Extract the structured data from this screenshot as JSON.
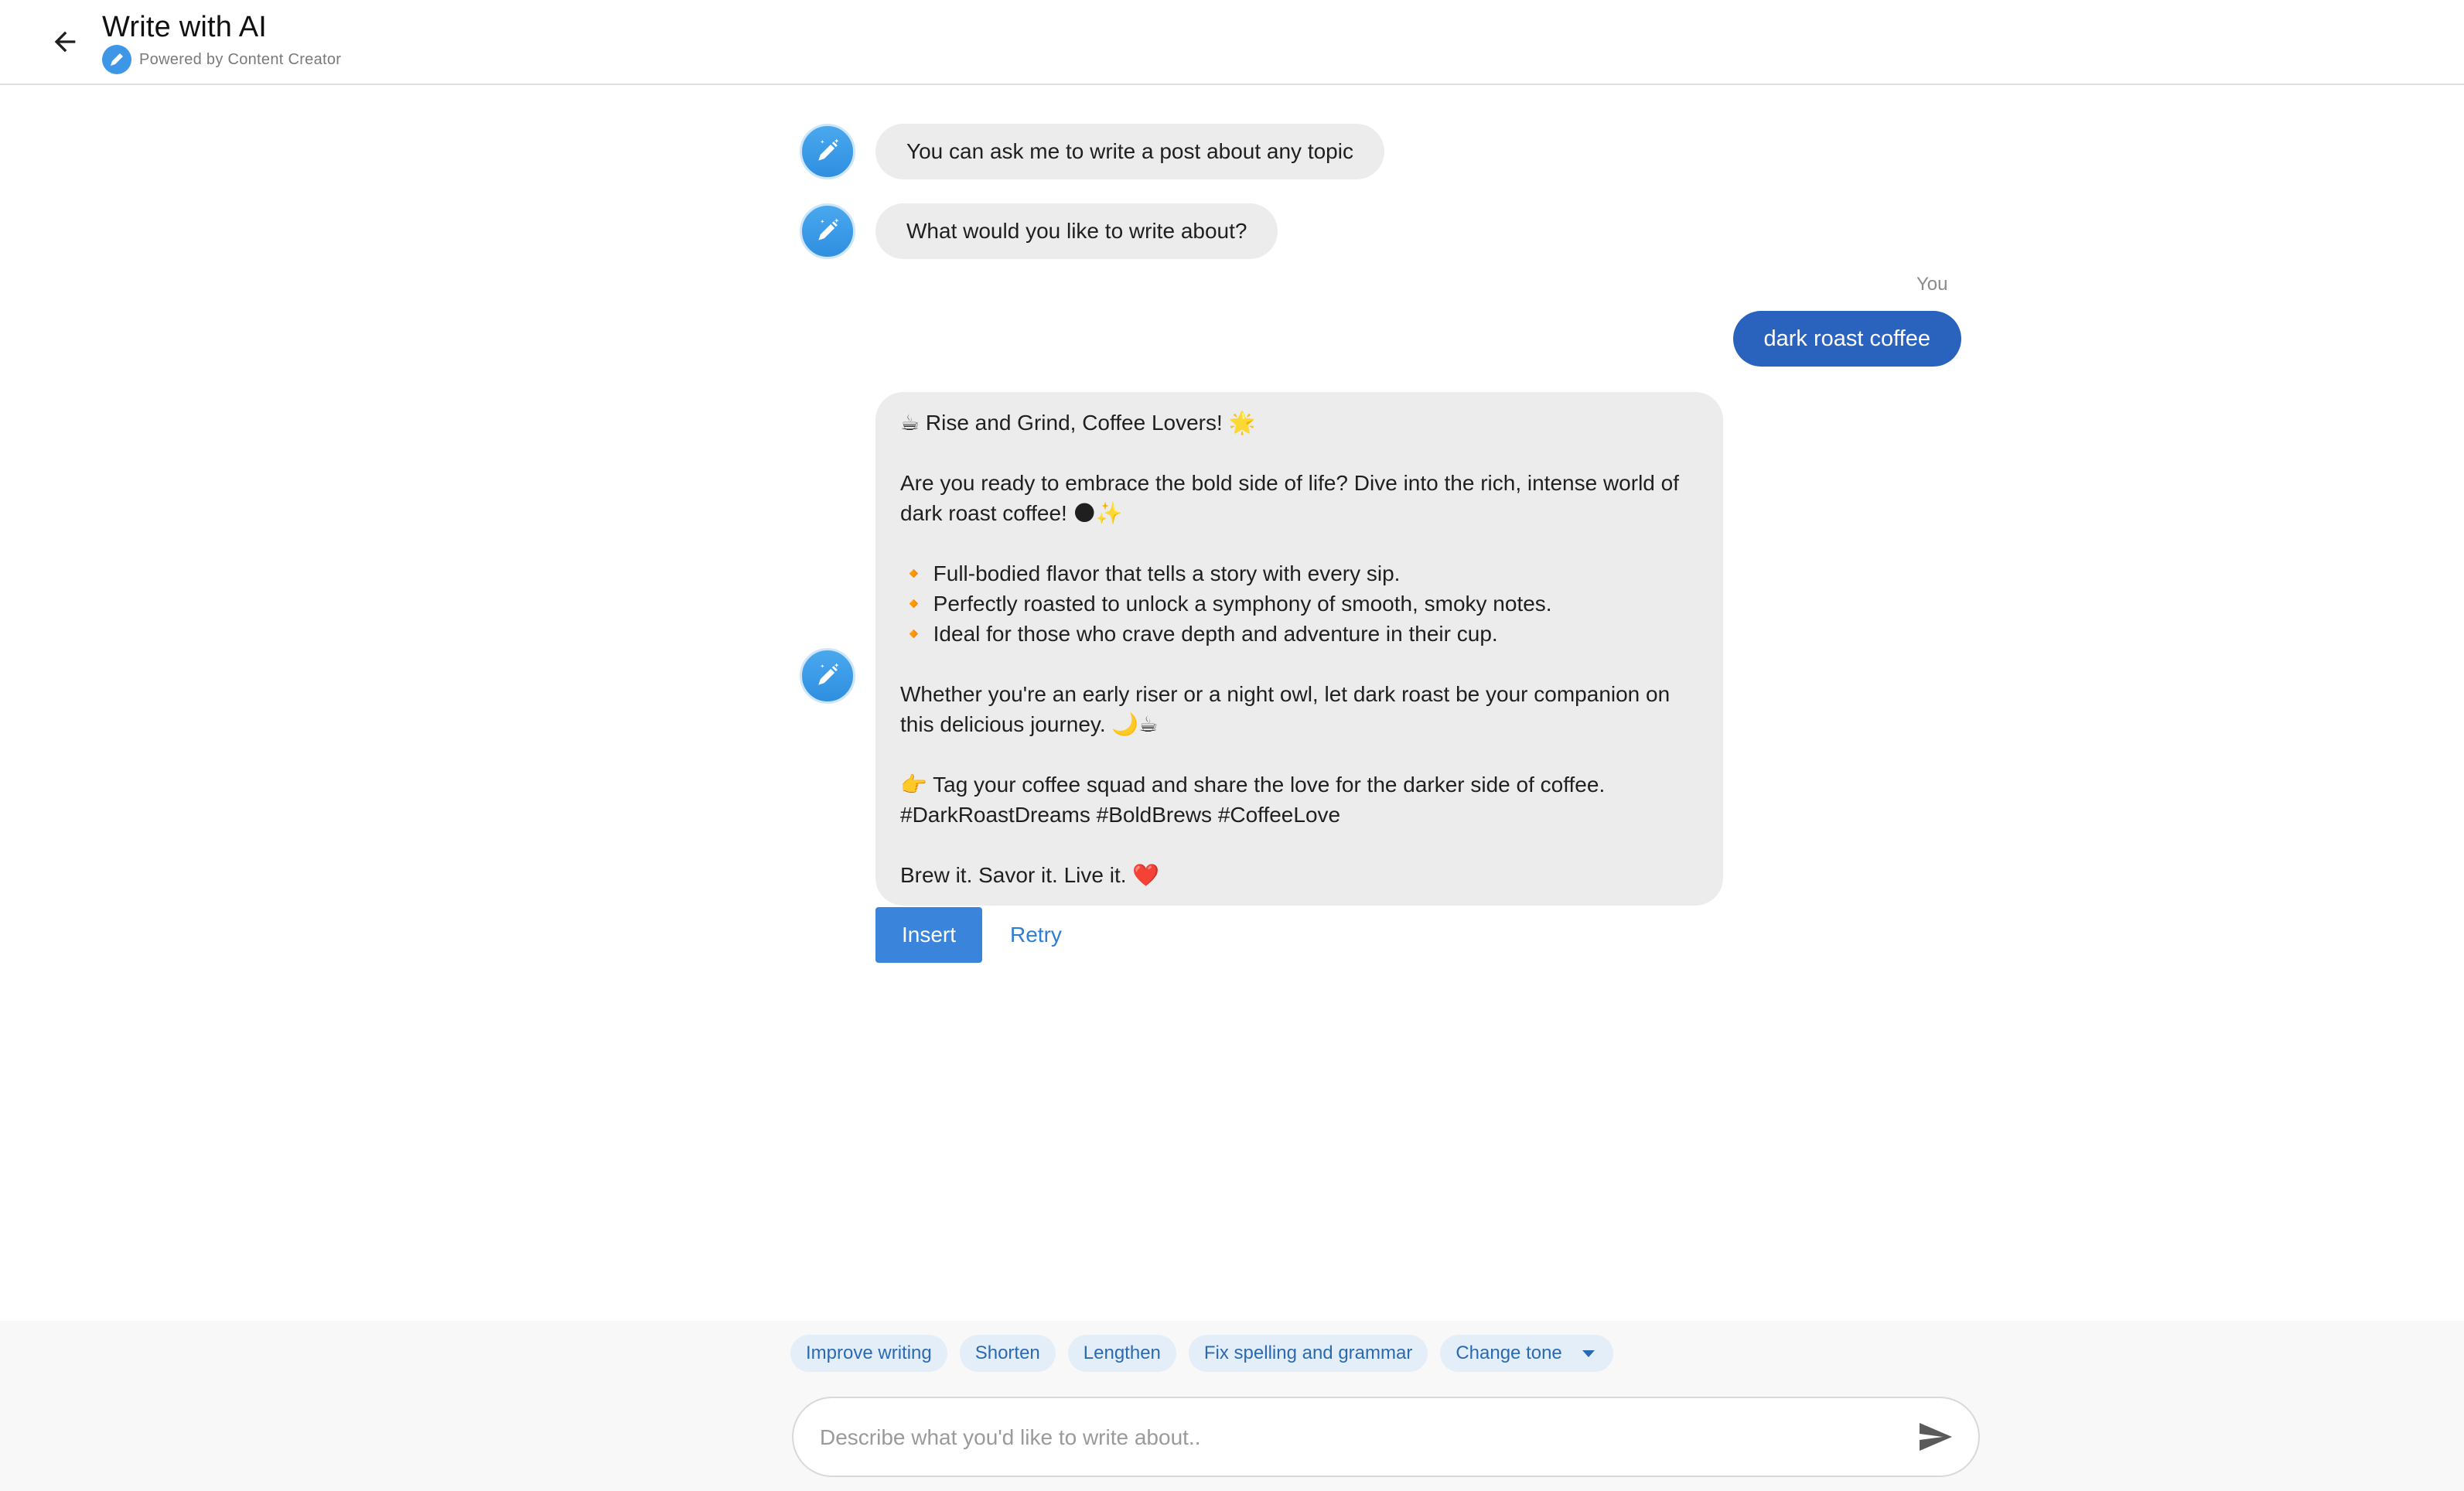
{
  "header": {
    "title": "Write with AI",
    "powered_by": "Powered by Content Creator"
  },
  "messages": {
    "assistant_1": "You can ask me to write a post about any topic",
    "assistant_2": "What would you like to write about?",
    "you_label": "You",
    "user_1": "dark roast coffee",
    "response": {
      "line1": "☕ Rise and Grind, Coffee Lovers! 🌟",
      "line2": "Are you ready to embrace the bold side of life? Dive into the rich, intense world of dark roast coffee! 🌑✨",
      "bullet1": "🔸 Full-bodied flavor that tells a story with every sip.",
      "bullet2": "🔸 Perfectly roasted to unlock a symphony of smooth, smoky notes.",
      "bullet3": "🔸 Ideal for those who crave depth and adventure in their cup.",
      "line3": "Whether you're an early riser or a night owl, let dark roast be your companion on this delicious journey. 🌙☕",
      "line4": "👉 Tag your coffee squad and share the love for the darker side of coffee.",
      "hashtags": "#DarkRoastDreams #BoldBrews #CoffeeLove",
      "line5": "Brew it. Savor it. Live it. ❤️"
    }
  },
  "actions": {
    "insert": "Insert",
    "retry": "Retry"
  },
  "chips": {
    "improve": "Improve writing",
    "shorten": "Shorten",
    "lengthen": "Lengthen",
    "fix": "Fix spelling and grammar",
    "tone": "Change tone"
  },
  "composer": {
    "placeholder": "Describe what you'd like to write about.."
  },
  "colors": {
    "accent": "#3a84db",
    "user_bubble": "#2a63bd",
    "assistant_bubble": "#ececec",
    "chip_bg": "#e4eef8"
  }
}
